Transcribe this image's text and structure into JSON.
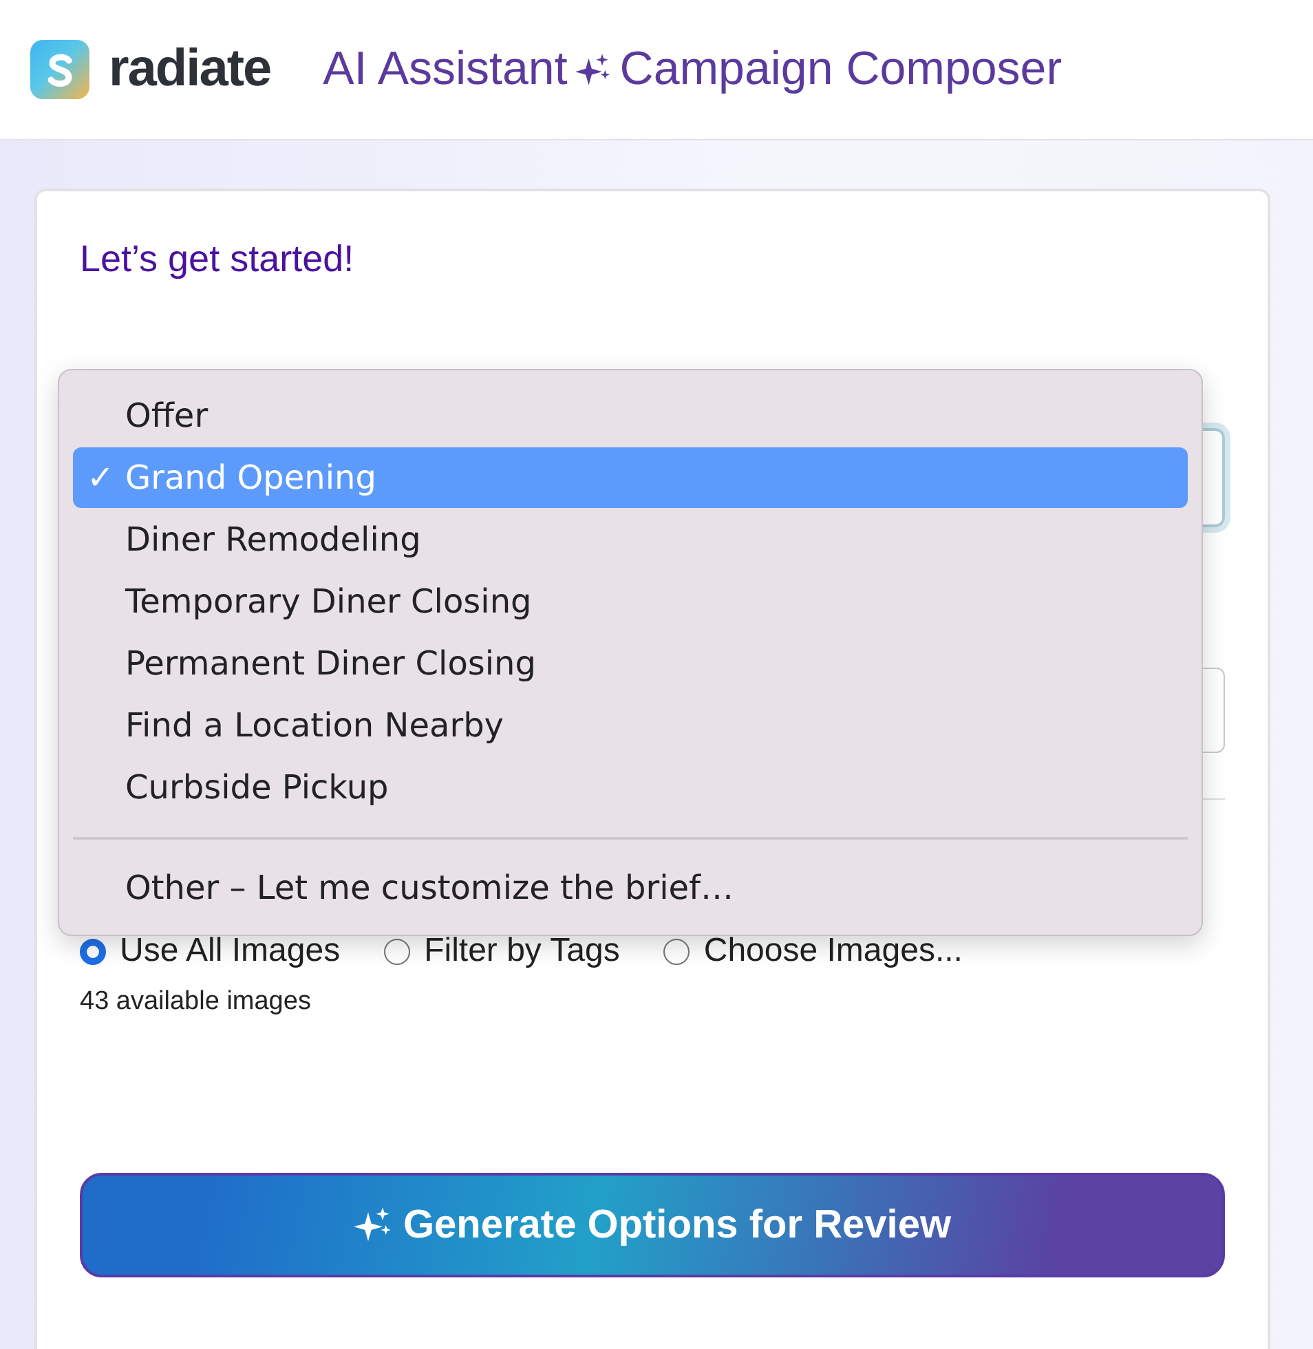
{
  "header": {
    "brand": "radiate",
    "title_left": "AI Assistant",
    "title_right": "Campaign Composer"
  },
  "card": {
    "heading": "Let’s get started!",
    "image_source": [
      {
        "label": "Use All Images",
        "selected": true
      },
      {
        "label": "Filter by Tags",
        "selected": false
      },
      {
        "label": "Choose Images...",
        "selected": false
      }
    ],
    "image_count": "43 available images",
    "generate_button": "Generate Options for Review"
  },
  "menu": {
    "items": [
      {
        "label": "Offer",
        "selected": false,
        "separator_before": false
      },
      {
        "label": "Grand Opening",
        "selected": true,
        "separator_before": false
      },
      {
        "label": "Diner Remodeling",
        "selected": false,
        "separator_before": false
      },
      {
        "label": "Temporary Diner Closing",
        "selected": false,
        "separator_before": false
      },
      {
        "label": "Permanent Diner Closing",
        "selected": false,
        "separator_before": false
      },
      {
        "label": "Find a Location Nearby",
        "selected": false,
        "separator_before": false
      },
      {
        "label": "Curbside Pickup",
        "selected": false,
        "separator_before": false
      },
      {
        "label": "Other – Let me customize the brief…",
        "selected": false,
        "separator_before": true
      }
    ],
    "check_mark": "✓"
  }
}
